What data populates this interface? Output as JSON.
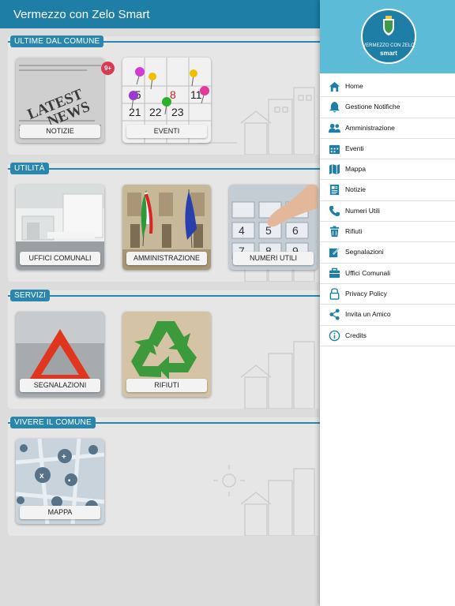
{
  "app": {
    "title": "Vermezzo con Zelo Smart"
  },
  "colors": {
    "primary": "#1f7ea6",
    "drawer_header": "#5cbbd7",
    "badge": "#d93a52"
  },
  "sections": [
    {
      "label": "ULTIME DAL COMUNE",
      "tiles": [
        {
          "label": "NOTIZIE",
          "image": "latest-news-newspaper",
          "badge": "9+"
        },
        {
          "label": "EVENTI",
          "image": "calendar-with-pins"
        }
      ]
    },
    {
      "label": "UTILITÀ",
      "tiles": [
        {
          "label": "UFFICI COMUNALI",
          "image": "office-interior"
        },
        {
          "label": "AMMINISTRAZIONE",
          "image": "town-hall-flags"
        },
        {
          "label": "NUMERI UTILI",
          "image": "phone-keypad-finger"
        }
      ]
    },
    {
      "label": "SERVIZI",
      "tiles": [
        {
          "label": "SEGNALAZIONI",
          "image": "warning-triangle"
        },
        {
          "label": "RIFIUTI",
          "image": "recycle-symbol"
        }
      ]
    },
    {
      "label": "VIVERE IL COMUNE",
      "tiles": [
        {
          "label": "MAPPA",
          "image": "city-map-pins"
        }
      ]
    }
  ],
  "drawer": {
    "logo": {
      "line1": "VERMEZZO CON ZELO",
      "line2": "smart"
    },
    "items": [
      {
        "label": "Home",
        "icon": "home-icon"
      },
      {
        "label": "Gestione Notifiche",
        "icon": "bell-icon"
      },
      {
        "label": "Amministrazione",
        "icon": "people-icon"
      },
      {
        "label": "Eventi",
        "icon": "calendar-icon"
      },
      {
        "label": "Mappa",
        "icon": "map-icon"
      },
      {
        "label": "Notizie",
        "icon": "newspaper-icon"
      },
      {
        "label": "Numeri Utili",
        "icon": "phone-icon"
      },
      {
        "label": "Rifiuti",
        "icon": "trash-icon"
      },
      {
        "label": "Segnalazioni",
        "icon": "edit-icon"
      },
      {
        "label": "Uffici Comunali",
        "icon": "briefcase-icon"
      },
      {
        "label": "Privacy Policy",
        "icon": "lock-icon"
      },
      {
        "label": "Invita un Amico",
        "icon": "share-icon"
      },
      {
        "label": "Credits",
        "icon": "info-icon"
      }
    ]
  }
}
